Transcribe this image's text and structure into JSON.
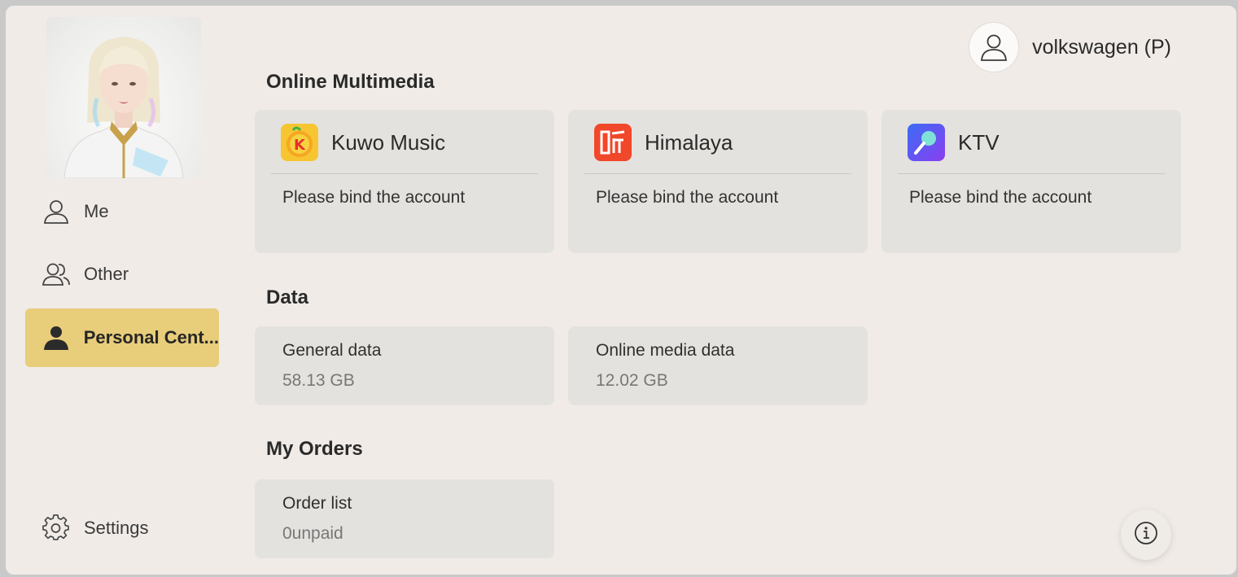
{
  "sidebar": {
    "items": [
      {
        "label": "Me",
        "icon": "person-outline-icon"
      },
      {
        "label": "Other",
        "icon": "people-outline-icon"
      },
      {
        "label": "Personal Cent...",
        "icon": "person-filled-icon",
        "active": true
      }
    ],
    "settings_label": "Settings"
  },
  "header": {
    "username": "volkswagen (P)"
  },
  "sections": {
    "media_title": "Online Multimedia",
    "data_title": "Data",
    "orders_title": "My Orders"
  },
  "media": [
    {
      "name": "Kuwo Music",
      "status": "Please bind the account",
      "icon": "kuwo-music-icon",
      "color": "#f7c531"
    },
    {
      "name": "Himalaya",
      "status": "Please bind the account",
      "icon": "himalaya-icon",
      "color": "#f1472a"
    },
    {
      "name": "KTV",
      "status": "Please bind the account",
      "icon": "ktv-icon",
      "color": "#5b5cf0"
    }
  ],
  "data": [
    {
      "label": "General data",
      "value": "58.13 GB"
    },
    {
      "label": "Online media data",
      "value": "12.02 GB"
    }
  ],
  "orders": [
    {
      "label": "Order list",
      "value": "0unpaid"
    }
  ],
  "colors": {
    "background": "#f0ebe7",
    "card": "#e4e2de",
    "active_nav": "#e8cd7a"
  }
}
